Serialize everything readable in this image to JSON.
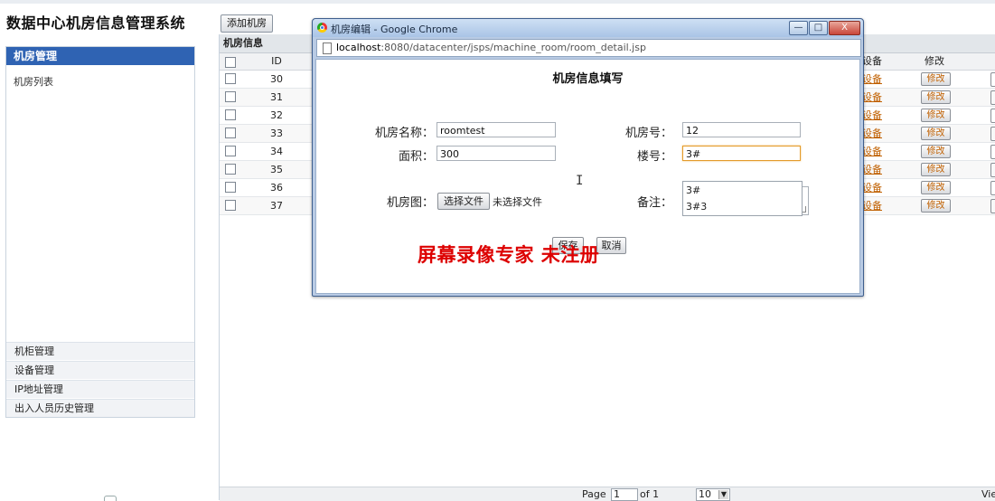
{
  "app": {
    "title": "数据中心机房信息管理系统"
  },
  "sidebar": {
    "header": "机房管理",
    "sub_items": [
      "机房列表"
    ],
    "panels": [
      "机柜管理",
      "设备管理",
      "IP地址管理",
      "出入人员历史管理"
    ]
  },
  "toolbar": {
    "add_label": "添加机房"
  },
  "grid": {
    "title": "机房信息",
    "columns": {
      "id": "ID",
      "device": "设备",
      "edit": "修改"
    },
    "rows": [
      {
        "id": "30",
        "device": "设备",
        "edit": "修改"
      },
      {
        "id": "31",
        "device": "设备",
        "edit": "修改"
      },
      {
        "id": "32",
        "device": "设备",
        "edit": "修改"
      },
      {
        "id": "33",
        "device": "设备",
        "edit": "修改"
      },
      {
        "id": "34",
        "device": "设备",
        "edit": "修改"
      },
      {
        "id": "35",
        "device": "设备",
        "edit": "修改"
      },
      {
        "id": "36",
        "device": "设备",
        "edit": "修改"
      },
      {
        "id": "37",
        "device": "设备",
        "edit": "修改"
      }
    ]
  },
  "pager": {
    "page_label": "Page",
    "page_value": "1",
    "of_label": "of 1",
    "page_size": "10",
    "right_text": "Vie"
  },
  "popup": {
    "window_title": "机房编辑 - Google Chrome",
    "url_host": "localhost",
    "url_rest": ":8080/datacenter/jsps/machine_room/room_detail.jsp",
    "buttons": {
      "minimize": "—",
      "maximize": "□",
      "close": "X"
    },
    "form": {
      "title": "机房信息填写",
      "name_label": "机房名称：",
      "name_value": "roomtest",
      "number_label": "机房号：",
      "number_value": "12",
      "area_label": "面积：",
      "area_value": "300",
      "floor_label": "楼号：",
      "floor_value": "3#",
      "floor_suggestions": [
        "3#",
        "3#3"
      ],
      "image_label": "机房图：",
      "file_button": "选择文件",
      "file_status": "未选择文件",
      "note_label": "备注：",
      "save_label": "保存",
      "cancel_label": "取消"
    },
    "watermark": "屏幕录像专家  未注册",
    "cursor": "I"
  },
  "colors": {
    "accent": "#2f63b3",
    "link": "#c06000",
    "watermark": "#dd0000"
  }
}
